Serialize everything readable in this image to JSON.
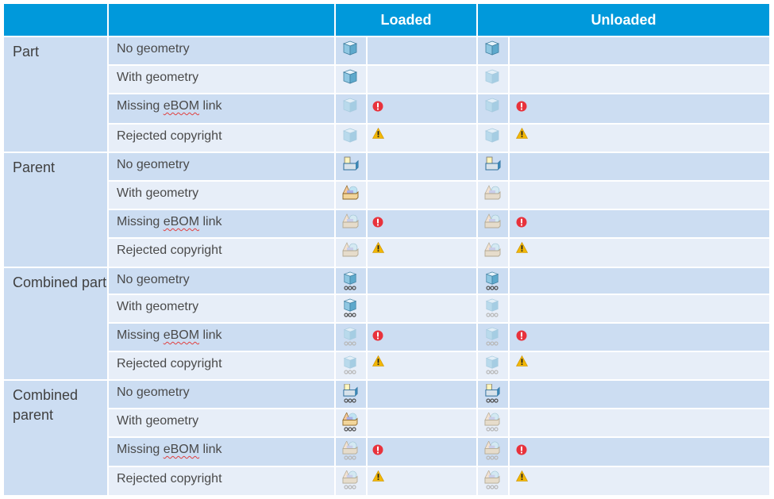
{
  "header": {
    "col_group": "",
    "col_state": "",
    "loaded": "Loaded",
    "unloaded": "Unloaded"
  },
  "colors": {
    "header_bg": "#0099DB",
    "row_dark": "#CCDDF2",
    "row_light": "#E7EEF8",
    "error": "#E8323C",
    "warning": "#F2B705"
  },
  "groups": [
    {
      "label": "Part",
      "icon_type": "part",
      "rows": [
        {
          "label": "No geometry",
          "loaded": {
            "icon": "part-icon",
            "state": "normal",
            "status": ""
          },
          "unloaded": {
            "icon": "part-icon",
            "state": "normal",
            "status": ""
          }
        },
        {
          "label": "With geometry",
          "loaded": {
            "icon": "part-icon",
            "state": "normal",
            "status": ""
          },
          "unloaded": {
            "icon": "part-icon",
            "state": "faded",
            "status": ""
          }
        },
        {
          "label": "Missing eBOM link",
          "loaded": {
            "icon": "part-icon",
            "state": "faded",
            "status": "error-icon"
          },
          "unloaded": {
            "icon": "part-icon",
            "state": "faded",
            "status": "error-icon"
          }
        },
        {
          "label": "Rejected copyright",
          "loaded": {
            "icon": "part-icon",
            "state": "faded",
            "status": "warning-icon"
          },
          "unloaded": {
            "icon": "part-icon",
            "state": "faded",
            "status": "warning-icon"
          }
        }
      ]
    },
    {
      "label": "Parent",
      "icon_type": "parent",
      "rows": [
        {
          "label": "No geometry",
          "loaded": {
            "icon": "parent-empty-icon",
            "state": "normal",
            "status": ""
          },
          "unloaded": {
            "icon": "parent-empty-icon",
            "state": "normal",
            "status": ""
          }
        },
        {
          "label": "With geometry",
          "loaded": {
            "icon": "parent-geometry-icon",
            "state": "normal",
            "status": ""
          },
          "unloaded": {
            "icon": "parent-geometry-icon",
            "state": "faded",
            "status": ""
          }
        },
        {
          "label": "Missing eBOM link",
          "loaded": {
            "icon": "parent-geometry-icon",
            "state": "faded",
            "status": "error-icon"
          },
          "unloaded": {
            "icon": "parent-geometry-icon",
            "state": "faded",
            "status": "error-icon"
          }
        },
        {
          "label": "Rejected copyright",
          "loaded": {
            "icon": "parent-geometry-icon",
            "state": "faded",
            "status": "warning-icon"
          },
          "unloaded": {
            "icon": "parent-geometry-icon",
            "state": "faded",
            "status": "warning-icon"
          }
        }
      ]
    },
    {
      "label": "Combined part",
      "icon_type": "combined-part",
      "rows": [
        {
          "label": "No geometry",
          "loaded": {
            "icon": "combined-part-icon",
            "state": "normal",
            "status": ""
          },
          "unloaded": {
            "icon": "combined-part-icon",
            "state": "normal",
            "status": ""
          }
        },
        {
          "label": "With geometry",
          "loaded": {
            "icon": "combined-part-icon",
            "state": "normal",
            "status": ""
          },
          "unloaded": {
            "icon": "combined-part-icon",
            "state": "faded",
            "status": ""
          }
        },
        {
          "label": "Missing eBOM link",
          "loaded": {
            "icon": "combined-part-icon",
            "state": "faded",
            "status": "error-icon"
          },
          "unloaded": {
            "icon": "combined-part-icon",
            "state": "faded",
            "status": "error-icon"
          }
        },
        {
          "label": "Rejected copyright",
          "loaded": {
            "icon": "combined-part-icon",
            "state": "faded",
            "status": "warning-icon"
          },
          "unloaded": {
            "icon": "combined-part-icon",
            "state": "faded",
            "status": "warning-icon"
          }
        }
      ]
    },
    {
      "label": "Combined parent",
      "icon_type": "combined-parent",
      "rows": [
        {
          "label": "No geometry",
          "loaded": {
            "icon": "combined-parent-empty-icon",
            "state": "normal",
            "status": ""
          },
          "unloaded": {
            "icon": "combined-parent-empty-icon",
            "state": "normal",
            "status": ""
          }
        },
        {
          "label": "With geometry",
          "loaded": {
            "icon": "combined-parent-geometry-icon",
            "state": "normal",
            "status": ""
          },
          "unloaded": {
            "icon": "combined-parent-geometry-icon",
            "state": "faded",
            "status": ""
          }
        },
        {
          "label": "Missing eBOM link",
          "loaded": {
            "icon": "combined-parent-geometry-icon",
            "state": "faded",
            "status": "error-icon"
          },
          "unloaded": {
            "icon": "combined-parent-geometry-icon",
            "state": "faded",
            "status": "error-icon"
          }
        },
        {
          "label": "Rejected copyright",
          "loaded": {
            "icon": "combined-parent-geometry-icon",
            "state": "faded",
            "status": "warning-icon"
          },
          "unloaded": {
            "icon": "combined-parent-geometry-icon",
            "state": "faded",
            "status": "warning-icon"
          }
        }
      ]
    }
  ]
}
